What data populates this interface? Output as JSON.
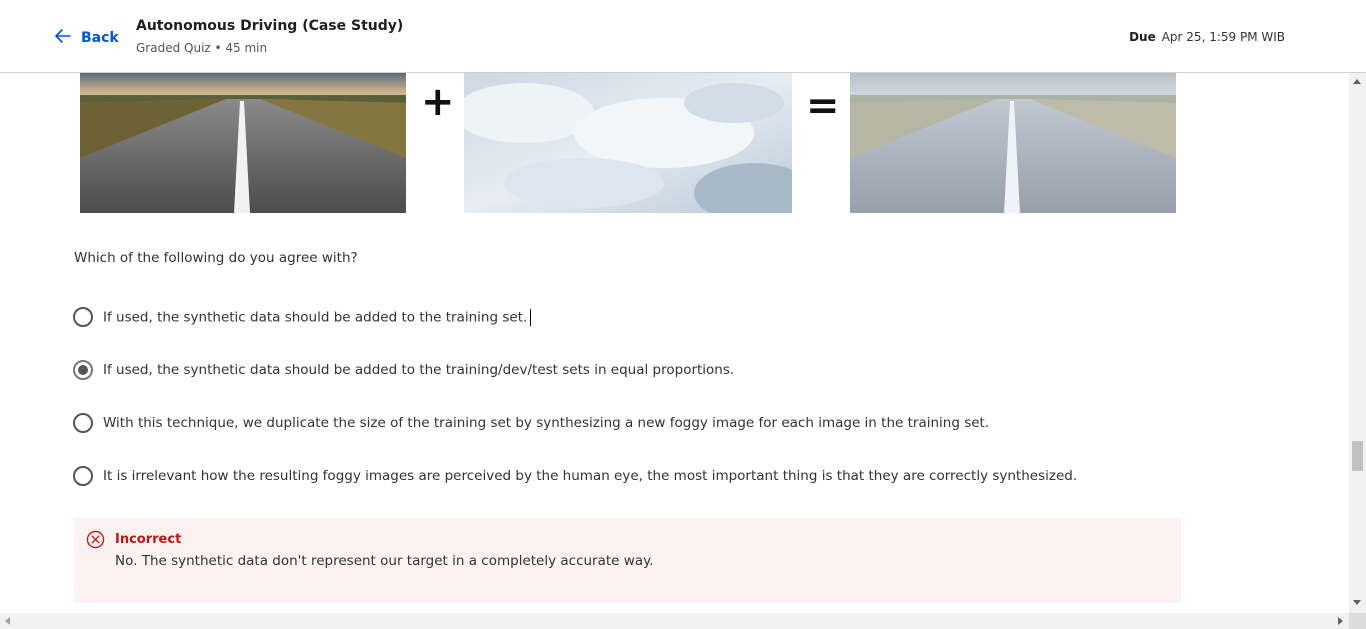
{
  "header": {
    "back_label": "Back",
    "title": "Autonomous Driving (Case Study)",
    "subtitle": "Graded Quiz • 45 min",
    "due_label": "Due",
    "due_value": "Apr 25, 1:59 PM WIB"
  },
  "figure": {
    "plus": "+",
    "equals": "="
  },
  "question": {
    "text": "Which of the following do you agree with?",
    "options": [
      {
        "label": "If used, the synthetic data should be added to the training set.",
        "selected": false
      },
      {
        "label": "If used, the synthetic data should be added to the training/dev/test sets in equal proportions.",
        "selected": true
      },
      {
        "label": "With this technique, we duplicate the size of the training set by synthesizing a new foggy image for each image in the training set.",
        "selected": false
      },
      {
        "label": "It is irrelevant how the resulting foggy images are perceived by the human eye, the most important thing is that they are correctly synthesized.",
        "selected": false
      }
    ]
  },
  "feedback": {
    "status": "Incorrect",
    "message": "No. The synthetic data don't represent our target in a completely accurate way."
  },
  "colors": {
    "accent": "#0056d2",
    "error": "#c21414",
    "feedback_bg": "#fdf2f2"
  }
}
